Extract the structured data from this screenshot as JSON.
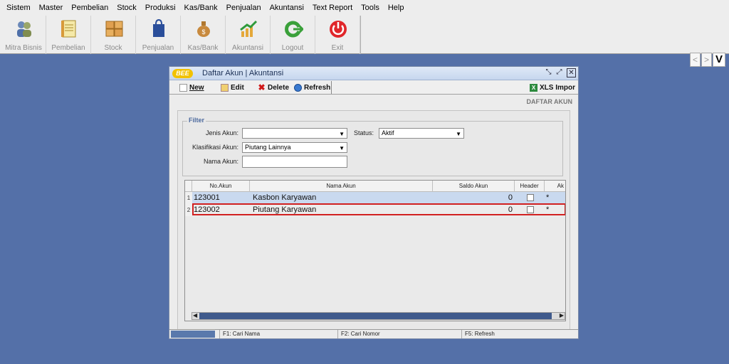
{
  "menu": [
    "Sistem",
    "Master",
    "Pembelian",
    "Stock",
    "Produksi",
    "Kas/Bank",
    "Penjualan",
    "Akuntansi",
    "Text Report",
    "Tools",
    "Help"
  ],
  "toolbar": {
    "buttons": [
      {
        "label": "Mitra Bisnis",
        "icon": "people-icon"
      },
      {
        "label": "Pembelian",
        "icon": "notebook-icon"
      },
      {
        "label": "Stock",
        "icon": "boxes-icon"
      },
      {
        "label": "Penjualan",
        "icon": "shopping-bag-icon"
      },
      {
        "label": "Kas/Bank",
        "icon": "money-bag-icon"
      },
      {
        "label": "Akuntansi",
        "icon": "chart-up-icon"
      },
      {
        "label": "Logout",
        "icon": "logout-arrow-icon"
      },
      {
        "label": "Exit",
        "icon": "power-icon"
      }
    ],
    "nav_prev": "<",
    "nav_next": ">",
    "nav_v": "V"
  },
  "window": {
    "logo": "BEE",
    "title": "Daftar Akun | Akuntansi",
    "toolbar": {
      "new": "New",
      "edit": "Edit",
      "delete": "Delete",
      "refresh": "Refresh",
      "xls": "XLS Impor"
    },
    "heading": "DAFTAR AKUN"
  },
  "filter": {
    "legend": "Filter",
    "jenis_label": "Jenis Akun:",
    "jenis_value": "",
    "status_label": "Status:",
    "status_value": "Aktif",
    "klasifikasi_label": "Klasifikasi Akun:",
    "klasifikasi_value": "Piutang Lainnya",
    "nama_label": "Nama Akun:",
    "nama_value": ""
  },
  "grid": {
    "columns": [
      "No.Akun",
      "Nama Akun",
      "Saldo Akun",
      "Header",
      "Ak"
    ],
    "rows": [
      {
        "num": "1",
        "no": "123001",
        "nama": "Kasbon Karyawan",
        "saldo": "0",
        "header": false,
        "extra": "*"
      },
      {
        "num": "2",
        "no": "123002",
        "nama": "Piutang Karyawan",
        "saldo": "0",
        "header": false,
        "extra": "*"
      }
    ]
  },
  "statusbar": {
    "f1": "F1: Cari Nama",
    "f2": "F2: Cari Nomor",
    "f5": "F5: Refresh"
  },
  "colors": {
    "desktop": "#5470a8",
    "selected_row": "#c9d9ef",
    "highlight": "#d12020"
  }
}
